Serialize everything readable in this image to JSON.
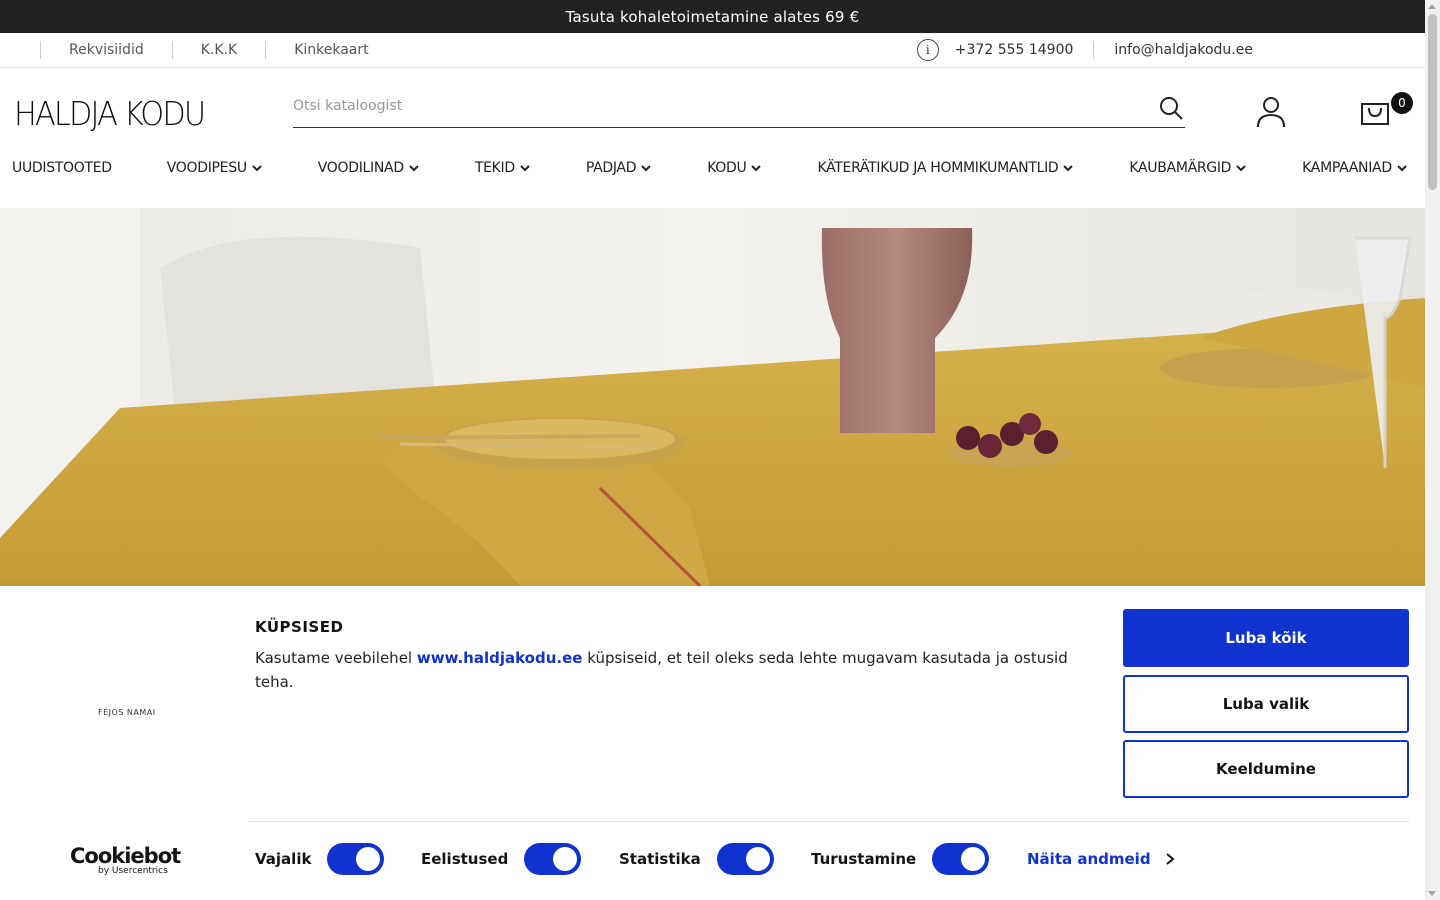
{
  "promo": {
    "text": "Tasuta kohaletoimetamine alates 69 €"
  },
  "util": {
    "links": [
      "Rekvisiidid",
      "K.K.K",
      "Kinkekaart"
    ],
    "phone": "+372 555 14900",
    "email": "info@haldjakodu.ee"
  },
  "header": {
    "logo": "HALDJA KODU",
    "search_placeholder": "Otsi kataloogist",
    "cart_count": "0"
  },
  "nav": [
    {
      "label": "UUDISTOOTED",
      "dropdown": false
    },
    {
      "label": "VOODIPESU",
      "dropdown": true
    },
    {
      "label": "VOODILINAD",
      "dropdown": true
    },
    {
      "label": "TEKID",
      "dropdown": true
    },
    {
      "label": "PADJAD",
      "dropdown": true
    },
    {
      "label": "KODU",
      "dropdown": true
    },
    {
      "label": "KÄTERÄTIKUD JA HOMMIKUMANTLID",
      "dropdown": true
    },
    {
      "label": "KAUBAMÄRGID",
      "dropdown": true
    },
    {
      "label": "KAMPAANIAD",
      "dropdown": true
    }
  ],
  "cookie": {
    "title": "KÜPSISED",
    "text_before": "Kasutame veebilehel ",
    "link": "www.haldjakodu.ee",
    "text_after": " küpsiseid, et teil oleks seda lehte mugavam kasutada ja ostusid teha.",
    "brand_small": "FÉJOS NAMAI",
    "accept_all": "Luba kõik",
    "accept_selection": "Luba valik",
    "deny": "Keeldumine",
    "toggles": [
      {
        "label": "Vajalik",
        "on": true
      },
      {
        "label": "Eelistused",
        "on": true
      },
      {
        "label": "Statistika",
        "on": true
      },
      {
        "label": "Turustamine",
        "on": true
      }
    ],
    "details": "Näita andmeid",
    "cookiebot": "Cookiebot",
    "cookiebot_sub": "by Usercentrics"
  },
  "colors": {
    "accent": "#1032cf",
    "promo_bg": "#222222"
  }
}
